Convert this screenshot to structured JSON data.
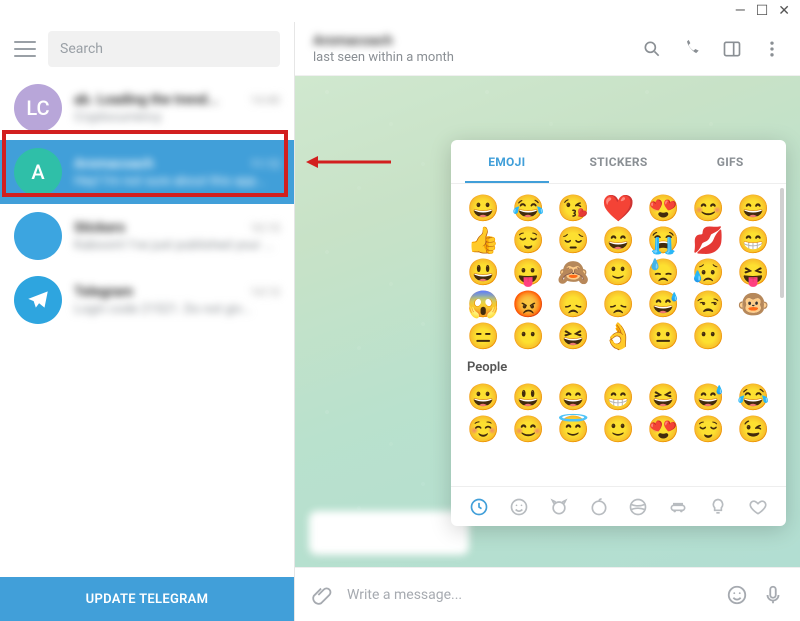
{
  "window": {
    "min": "—",
    "max": "☐",
    "close": "✕"
  },
  "sidebar": {
    "search_placeholder": "Search",
    "update_label": "UPDATE TELEGRAM",
    "items": [
      {
        "avatar_letter": "LC",
        "name": "ab. Loading the trend...",
        "preview": "Cryptocurrency",
        "time": "14:40"
      },
      {
        "avatar_letter": "A",
        "name": "Aromacoach",
        "preview": "Hey! I'm not sure about this app...",
        "time": "11:12"
      },
      {
        "avatar_letter": "",
        "name": "Stickers",
        "preview": "Kaboom! I've just published your ...",
        "time": "10:15"
      },
      {
        "avatar_letter": "",
        "name": "Telegram",
        "preview": "Login code 21521. Do not giv...",
        "time": "14:13"
      }
    ]
  },
  "conversation": {
    "name": "Aromacoach",
    "status": "last seen within a month"
  },
  "emoji": {
    "tabs": [
      "EMOJI",
      "STICKERS",
      "GIFS"
    ],
    "section_label": "People",
    "grid": [
      [
        "😀",
        "😂",
        "😘",
        "❤️",
        "😍",
        "😊",
        "😄"
      ],
      [
        "👍",
        "😌",
        "😔",
        "😄",
        "😭",
        "💋",
        "😁"
      ],
      [
        "😃",
        "😛",
        "🙈",
        "🙂",
        "😓",
        "😥",
        "😝"
      ],
      [
        "😱",
        "😡",
        "😞",
        "😞",
        "😅",
        "😒",
        "🐵"
      ],
      [
        "😑",
        "😶",
        "😆",
        "👌",
        "😐",
        "😶",
        ""
      ]
    ],
    "people": [
      [
        "😀",
        "😃",
        "😄",
        "😁",
        "😆",
        "😅",
        "😂"
      ],
      [
        "☺️",
        "😊",
        "😇",
        "🙂",
        "😍",
        "😌",
        "😉"
      ]
    ],
    "categories": [
      "recent",
      "smile",
      "animal",
      "food",
      "sport",
      "car",
      "bulb",
      "heart"
    ]
  },
  "compose": {
    "placeholder": "Write a message..."
  }
}
